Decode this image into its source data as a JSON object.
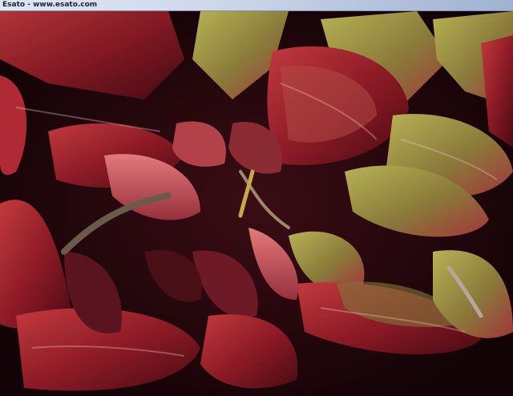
{
  "window": {
    "title": "Esato - www.esato.com"
  },
  "photo": {
    "subject": "foliage-icon"
  }
}
